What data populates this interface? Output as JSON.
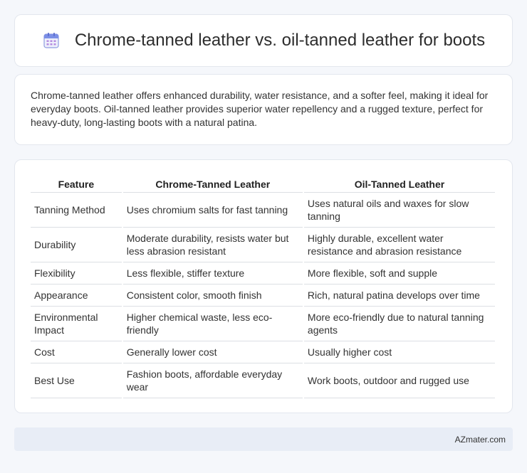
{
  "header": {
    "title": "Chrome-tanned leather vs. oil-tanned leather for boots",
    "icon": "calendar-icon"
  },
  "summary": {
    "text": "Chrome-tanned leather offers enhanced durability, water resistance, and a softer feel, making it ideal for everyday boots. Oil-tanned leather provides superior water repellency and a rugged texture, perfect for heavy-duty, long-lasting boots with a natural patina."
  },
  "table": {
    "headers": [
      "Feature",
      "Chrome-Tanned Leather",
      "Oil-Tanned Leather"
    ],
    "rows": [
      [
        "Tanning Method",
        "Uses chromium salts for fast tanning",
        "Uses natural oils and waxes for slow tanning"
      ],
      [
        "Durability",
        "Moderate durability, resists water but less abrasion resistant",
        "Highly durable, excellent water resistance and abrasion resistance"
      ],
      [
        "Flexibility",
        "Less flexible, stiffer texture",
        "More flexible, soft and supple"
      ],
      [
        "Appearance",
        "Consistent color, smooth finish",
        "Rich, natural patina develops over time"
      ],
      [
        "Environmental Impact",
        "Higher chemical waste, less eco-friendly",
        "More eco-friendly due to natural tanning agents"
      ],
      [
        "Cost",
        "Generally lower cost",
        "Usually higher cost"
      ],
      [
        "Best Use",
        "Fashion boots, affordable everyday wear",
        "Work boots, outdoor and rugged use"
      ]
    ]
  },
  "footer": {
    "brand": "AZmater.com"
  },
  "colors": {
    "background": "#f5f7fb",
    "card": "#ffffff",
    "footer": "#e8edf6",
    "icon_accent": "#8a6fd6"
  }
}
